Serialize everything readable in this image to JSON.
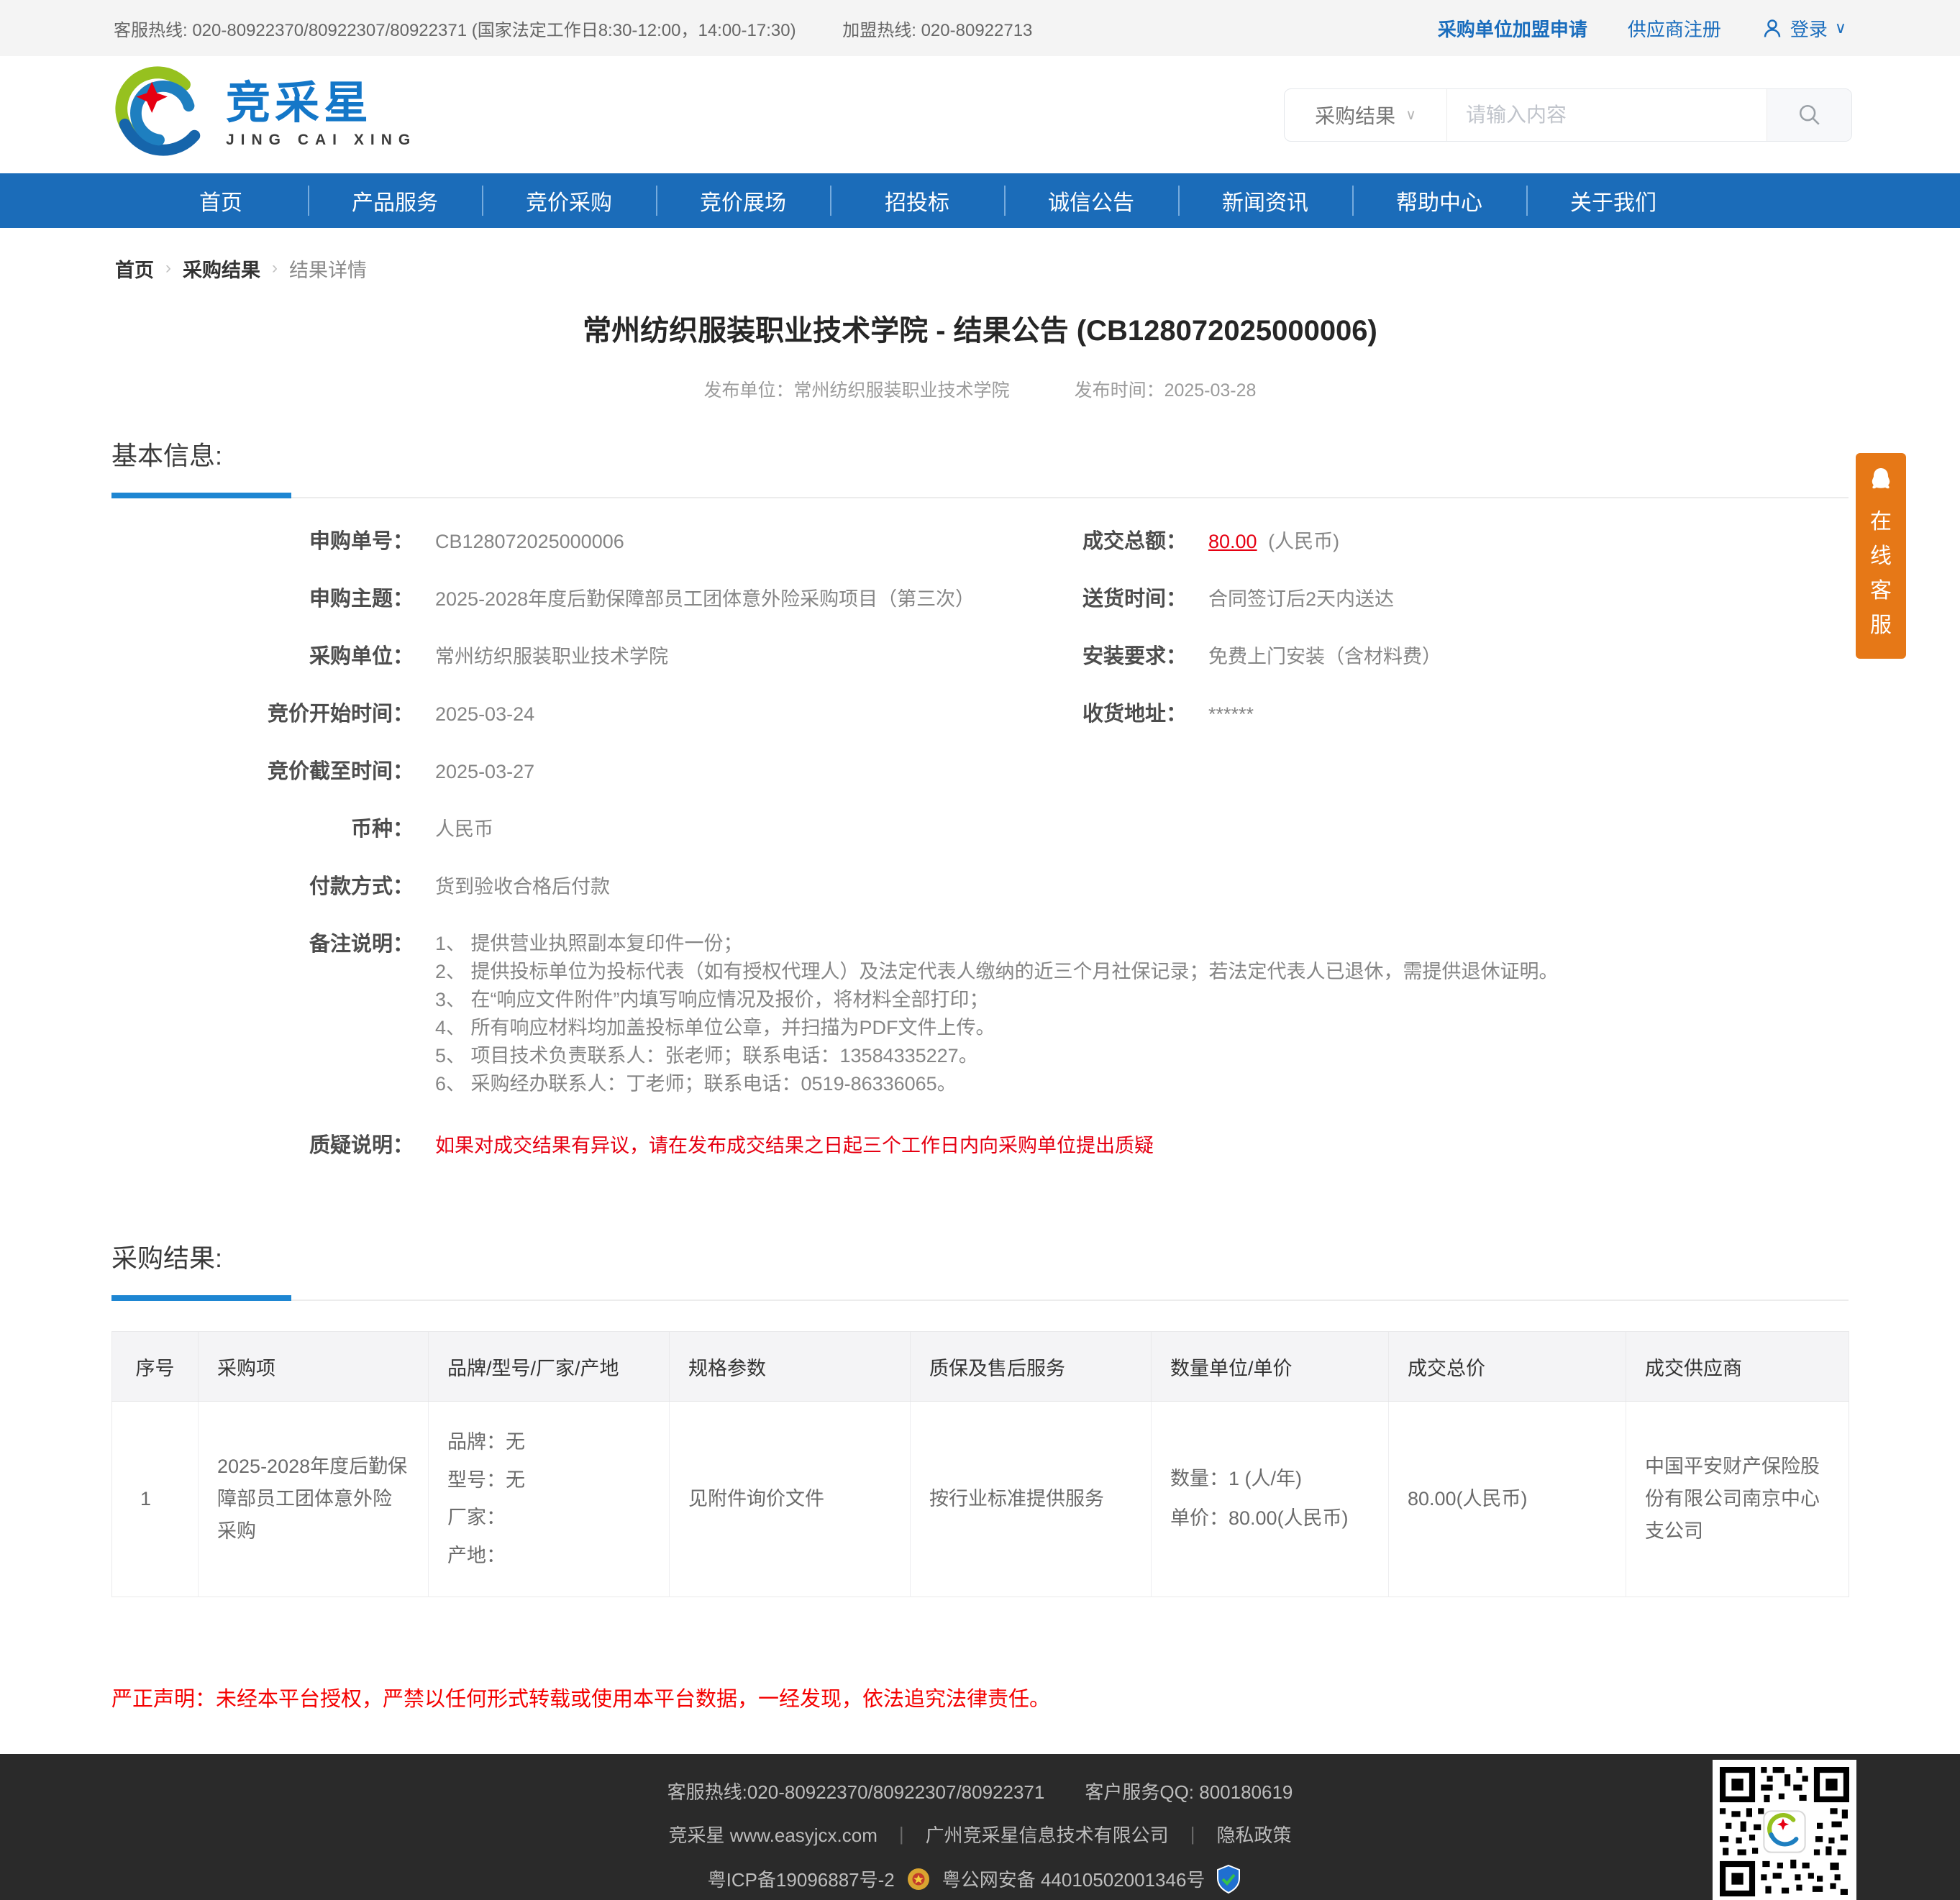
{
  "topbar": {
    "service_hotline": "客服热线: 020-80922370/80922307/80922371 (国家法定工作日8:30-12:00，14:00-17:30)",
    "join_hotline": "加盟热线: 020-80922713",
    "purchaser_join": "采购单位加盟申请",
    "supplier_register": "供应商注册",
    "login": "登录",
    "login_chevron": "∨"
  },
  "header": {
    "logo_text": "竞采星",
    "logo_subtext": "JING CAI XING",
    "search_category": "采购结果",
    "search_chevron": "∨",
    "search_placeholder": "请输入内容",
    "search_icon": "magnifier-icon"
  },
  "nav": {
    "items": [
      "首页",
      "产品服务",
      "竞价采购",
      "竞价展场",
      "招投标",
      "诚信公告",
      "新闻资讯",
      "帮助中心",
      "关于我们"
    ]
  },
  "breadcrumb": {
    "separator": "›",
    "items": [
      "首页",
      "采购结果",
      "结果详情"
    ]
  },
  "page": {
    "title": "常州纺织服装职业技术学院 - 结果公告 (CB128072025000006)",
    "publish_unit": "发布单位：常州纺织服装职业技术学院",
    "publish_time": "发布时间：2025-03-28"
  },
  "basic_info": {
    "section_title": "基本信息:",
    "left_fields": [
      {
        "label": "申购单号：",
        "value": "CB128072025000006"
      },
      {
        "label": "申购主题：",
        "value": "2025-2028年度后勤保障部员工团体意外险采购项目（第三次）"
      },
      {
        "label": "采购单位：",
        "value": "常州纺织服装职业技术学院"
      },
      {
        "label": "竞价开始时间：",
        "value": "2025-03-24"
      },
      {
        "label": "竞价截至时间：",
        "value": "2025-03-27"
      },
      {
        "label": "币种：",
        "value": "人民币"
      },
      {
        "label": "付款方式：",
        "value": "货到验收合格后付款"
      }
    ],
    "right_fields": {
      "total": {
        "label": "成交总额：",
        "amount": "80.00",
        "suffix": "(人民币)"
      },
      "delivery": {
        "label": "送货时间：",
        "value": "合同签订后2天内送达"
      },
      "install": {
        "label": "安装要求：",
        "value": "免费上门安装（含材料费）"
      },
      "address": {
        "label": "收货地址：",
        "value": "******"
      }
    },
    "remark": {
      "label": "备注说明：",
      "lines": [
        "1、 提供营业执照副本复印件一份；",
        "2、 提供投标单位为投标代表（如有授权代理人）及法定代表人缴纳的近三个月社保记录；若法定代表人已退休，需提供退休证明。",
        "3、 在“响应文件附件”内填写响应情况及报价，将材料全部打印；",
        "4、 所有响应材料均加盖投标单位公章，并扫描为PDF文件上传。",
        "5、 项目技术负责联系人：张老师；联系电话：13584335227。",
        "6、 采购经办联系人：丁老师；联系电话：0519-86336065。"
      ]
    },
    "question": {
      "label": "质疑说明：",
      "value": "如果对成交结果有异议，请在发布成交结果之日起三个工作日内向采购单位提出质疑"
    }
  },
  "result": {
    "section_title": "采购结果:",
    "table": {
      "headers": [
        "序号",
        "采购项",
        "品牌/型号/厂家/产地",
        "规格参数",
        "质保及售后服务",
        "数量单位/单价",
        "成交总价",
        "成交供应商"
      ],
      "rows": [
        {
          "no": "1",
          "item": "2025-2028年度后勤保障部员工团体意外险采购",
          "brand_lines": [
            "品牌：无",
            "型号：无",
            "厂家：",
            "产地："
          ],
          "spec": "见附件询价文件",
          "warranty": "按行业标准提供服务",
          "qty_lines": [
            "数量：1 (人/年)",
            "单价：80.00(人民币)"
          ],
          "total": "80.00(人民币)",
          "supplier": "中国平安财产保险股份有限公司南京中心支公司"
        }
      ]
    }
  },
  "statement": "严正声明：未经本平台授权，严禁以任何形式转载或使用本平台数据，一经发现，依法追究法律责任。",
  "footer": {
    "separator": "|",
    "hotline": "客服热线:020-80922370/80922307/80922371",
    "qq": "客户服务QQ: 800180619",
    "site": "竞采星 www.easyjcx.com",
    "company": "广州竞采星信息技术有限公司",
    "privacy": "隐私政策",
    "icp": "粤ICP备19096887号-2",
    "security": "粤公网安备 44010502001346号"
  },
  "cs_widget": {
    "text": "在线客服"
  },
  "colors": {
    "nav_blue": "#1b6cb9",
    "accent_blue": "#1e86d2",
    "link_blue": "#1a6dbd",
    "highlight_red": "#e60012",
    "statement_red": "#f40000",
    "widget_orange": "#e67817",
    "footer_bg": "#2a2a2a",
    "topbar_bg": "#f4f4f4"
  }
}
